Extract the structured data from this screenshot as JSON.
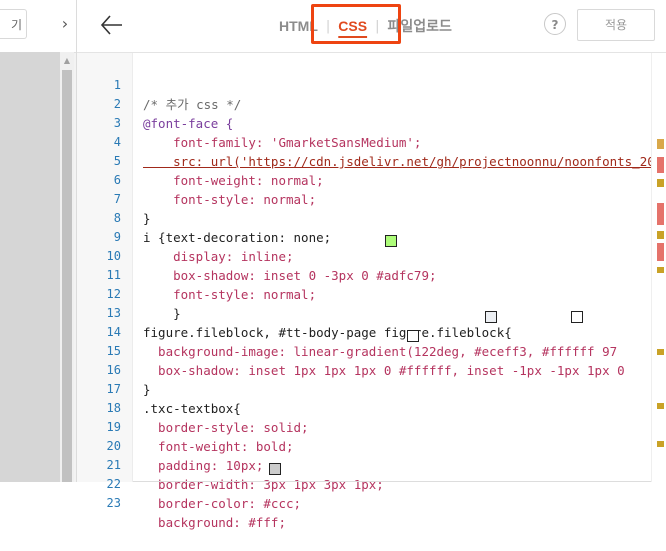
{
  "left_panel": {
    "button_label": "기",
    "chevron": "›"
  },
  "topbar": {
    "tabs": [
      "HTML",
      "CSS",
      "파일업로드"
    ],
    "active_tab": "CSS",
    "separator": "|",
    "help_label": "?",
    "apply_label": "적용"
  },
  "colors": {
    "active_tab": "#e04a1f",
    "highlight": "#ee4411",
    "swatch_green": "#adfc79",
    "swatch_light": "#eceff3",
    "swatch_white": "#ffffff",
    "swatch_gray": "#cccccc"
  },
  "code": {
    "lines": [
      {
        "n": "1",
        "text": "/* 추가 css */"
      },
      {
        "n": "2",
        "text": "@font-face {"
      },
      {
        "n": "3",
        "text": "    font-family: 'GmarketSansMedium';"
      },
      {
        "n": "4",
        "text": "    src: url('https://cdn.jsdelivr.net/gh/projectnoonnu/noonfonts_20"
      },
      {
        "n": "5",
        "text": "    font-weight: normal;"
      },
      {
        "n": "6",
        "text": "    font-style: normal;"
      },
      {
        "n": "7",
        "text": "}"
      },
      {
        "n": "8",
        "text": "i {text-decoration: none;"
      },
      {
        "n": "9",
        "text": "    display: inline;"
      },
      {
        "n": "10",
        "text": "    box-shadow: inset 0 -3px 0 #adfc79;"
      },
      {
        "n": "11",
        "text": "    font-style: normal;"
      },
      {
        "n": "12",
        "text": "    }"
      },
      {
        "n": "13",
        "text": "figure.fileblock, #tt-body-page figure.fileblock{"
      },
      {
        "n": "14",
        "text": "  background-image: linear-gradient(122deg, #eceff3, #ffffff 97"
      },
      {
        "n": "15",
        "text": "  box-shadow: inset 1px 1px 1px 0 #ffffff, inset -1px -1px 1px 0"
      },
      {
        "n": "16",
        "text": "}"
      },
      {
        "n": "17",
        "text": ".txc-textbox{"
      },
      {
        "n": "18",
        "text": "  border-style: solid;"
      },
      {
        "n": "19",
        "text": "  font-weight: bold;"
      },
      {
        "n": "20",
        "text": "  padding: 10px;"
      },
      {
        "n": "21",
        "text": "  border-width: 3px 1px 3px 1px;"
      },
      {
        "n": "22",
        "text": "  border-color: #ccc;"
      },
      {
        "n": "23",
        "text": "  background: #fff;"
      }
    ]
  }
}
